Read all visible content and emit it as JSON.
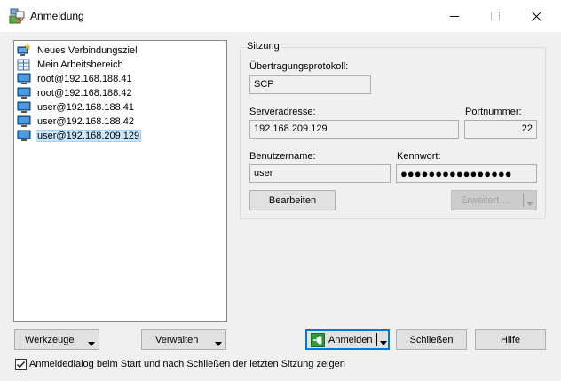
{
  "window": {
    "title": "Anmeldung",
    "icon": "winscp-app-icon"
  },
  "sites": [
    {
      "label": "Neues Verbindungsziel",
      "icon": "new-site-icon"
    },
    {
      "label": "Mein Arbeitsbereich",
      "icon": "workspace-icon"
    },
    {
      "label": "root@192.168.188.41",
      "icon": "computer-icon"
    },
    {
      "label": "root@192.168.188.42",
      "icon": "computer-icon"
    },
    {
      "label": "user@192.168.188.41",
      "icon": "computer-icon"
    },
    {
      "label": "user@192.168.188.42",
      "icon": "computer-icon"
    },
    {
      "label": "user@192.168.209.129",
      "icon": "computer-icon",
      "selected": true
    }
  ],
  "session": {
    "group_label": "Sitzung",
    "protocol_label": "Übertragungsprotokoll:",
    "protocol_value": "SCP",
    "host_label": "Serveradresse:",
    "host_value": "192.168.209.129",
    "port_label": "Portnummer:",
    "port_value": "22",
    "user_label": "Benutzername:",
    "user_value": "user",
    "password_label": "Kennwort:",
    "password_value": "●●●●●●●●●●●●●●●●",
    "edit_button": "Bearbeiten",
    "advanced_button": "Erweitert ..."
  },
  "buttons": {
    "tools": "Werkzeuge",
    "manage": "Verwalten",
    "login": "Anmelden",
    "close": "Schließen",
    "help": "Hilfe"
  },
  "footer": {
    "show_login_checkbox_label": "Anmeldedialog beim Start und nach Schließen der letzten Sitzung zeigen",
    "show_login_checked": true
  },
  "colors": {
    "selection": "#cce8ff",
    "default_button_border": "#0078d7",
    "monitor_blue": "#1e73be"
  }
}
